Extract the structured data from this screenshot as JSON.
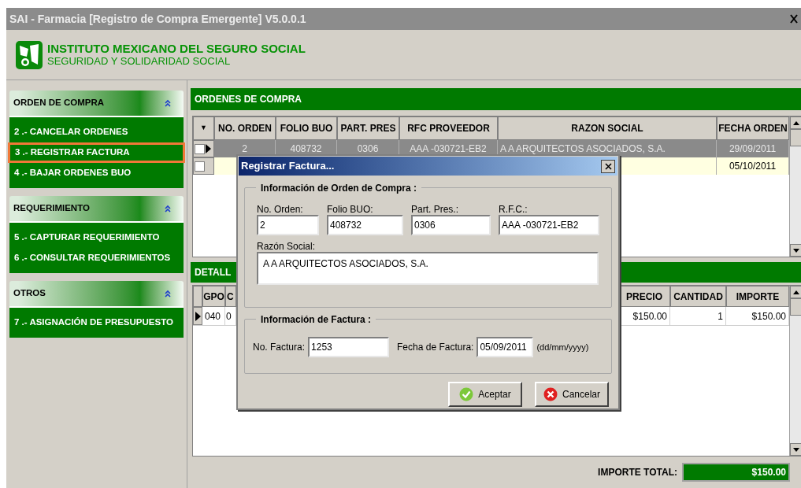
{
  "window": {
    "title": "SAI - Farmacia [Registro de Compra Emergente] V5.0.0.1"
  },
  "header": {
    "org": "INSTITUTO MEXICANO DEL SEGURO SOCIAL",
    "motto": "SEGURIDAD Y SOLIDARIDAD SOCIAL"
  },
  "sidebar": {
    "sections": [
      {
        "title": "ORDEN DE COMPRA",
        "expanded": true,
        "items": [
          {
            "label": "2 .- CANCELAR ORDENES",
            "selected": false
          },
          {
            "label": "3 .- REGISTRAR FACTURA",
            "selected": true
          },
          {
            "label": "4 .- BAJAR ORDENES BUO",
            "selected": false
          }
        ]
      },
      {
        "title": "REQUERIMIENTO",
        "expanded": true,
        "items": [
          {
            "label": "5 .- CAPTURAR REQUERIMIENTO",
            "selected": false
          },
          {
            "label": "6 .- CONSULTAR REQUERIMIENTOS",
            "selected": false
          }
        ]
      },
      {
        "title": "OTROS",
        "expanded": true,
        "items": [
          {
            "label": "7 .- ASIGNACIÓN DE PRESUPUESTO",
            "selected": false
          }
        ]
      }
    ]
  },
  "orders": {
    "title": "ORDENES DE COMPRA",
    "sort_glyph": "▼",
    "columns": [
      "NO. ORDEN",
      "FOLIO BUO",
      "PART. PRES",
      "RFC PROVEEDOR",
      "RAZON SOCIAL",
      "FECHA ORDEN"
    ],
    "rows": [
      {
        "selected": true,
        "checked": false,
        "cells": [
          "2",
          "408732",
          "0306",
          "AAA -030721-EB2",
          "A A ARQUITECTOS ASOCIADOS, S.A.",
          "29/09/2011"
        ]
      },
      {
        "selected": false,
        "checked": false,
        "cells": [
          "",
          "",
          "",
          "",
          "",
          "05/10/2011"
        ]
      }
    ]
  },
  "detail": {
    "title": "DETALL",
    "columns": [
      "GPO",
      "C",
      "PRECIO",
      "CANTIDAD",
      "IMPORTE"
    ],
    "rows": [
      {
        "selected": true,
        "cells": [
          "040",
          "0",
          "$150.00",
          "1",
          "$150.00"
        ]
      }
    ]
  },
  "total": {
    "label": "IMPORTE TOTAL:",
    "value": "$150.00"
  },
  "dialog": {
    "title": "Registrar Factura...",
    "order_group": {
      "legend": "Información de Orden de Compra :",
      "fields": [
        {
          "label": "No. Orden:",
          "value": "2"
        },
        {
          "label": "Folio BUO:",
          "value": "408732"
        },
        {
          "label": "Part. Pres.:",
          "value": "0306"
        },
        {
          "label": "R.F.C.:",
          "value": "AAA -030721-EB2"
        }
      ],
      "razon": {
        "label": "Razón Social:",
        "value": "A A ARQUITECTOS ASOCIADOS, S.A."
      }
    },
    "invoice_group": {
      "legend": "Información de Factura :",
      "number": {
        "label": "No. Factura:",
        "value": "1253"
      },
      "date": {
        "label": "Fecha de Factura:",
        "value": "05/09/2011"
      },
      "format_hint": "(dd/mm/yyyy)"
    },
    "buttons": [
      {
        "kind": "accept",
        "label": "Aceptar"
      },
      {
        "kind": "cancel",
        "label": "Cancelar"
      }
    ]
  }
}
